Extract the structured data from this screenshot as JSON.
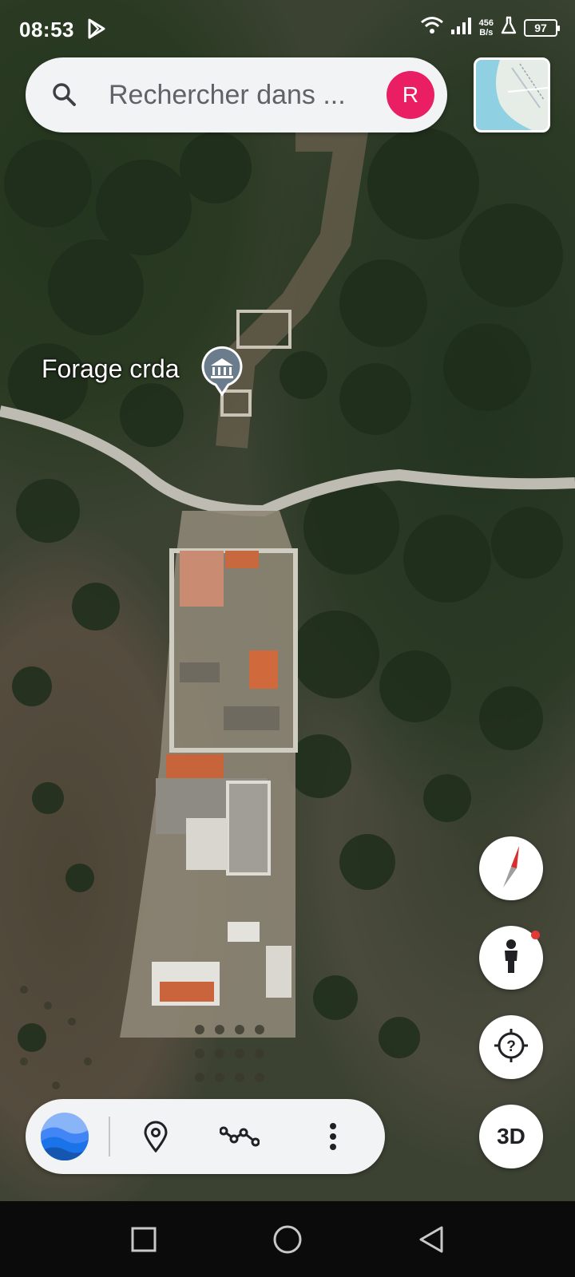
{
  "status_bar": {
    "time": "08:53",
    "net_speed_value": "456",
    "net_speed_unit": "B/s",
    "battery": "97",
    "icons": [
      "play-store-icon",
      "wifi-icon",
      "signal-icon",
      "lab-icon",
      "battery-icon"
    ]
  },
  "search": {
    "placeholder": "Rechercher dans ...",
    "avatar_initial": "R",
    "avatar_color": "#e91e63"
  },
  "map": {
    "place_label": "Forage crda",
    "place_icon": "institution-icon"
  },
  "controls": {
    "compass": "compass-icon",
    "street_view": "pegman-icon",
    "voyager": "question-target-icon",
    "three_d_label": "3D"
  },
  "toolbar": {
    "items": [
      "earth-logo-icon",
      "pin-icon",
      "measure-path-icon",
      "more-vert-icon"
    ]
  },
  "navigation": {
    "items": [
      "recent-apps-icon",
      "home-icon",
      "back-icon"
    ]
  }
}
